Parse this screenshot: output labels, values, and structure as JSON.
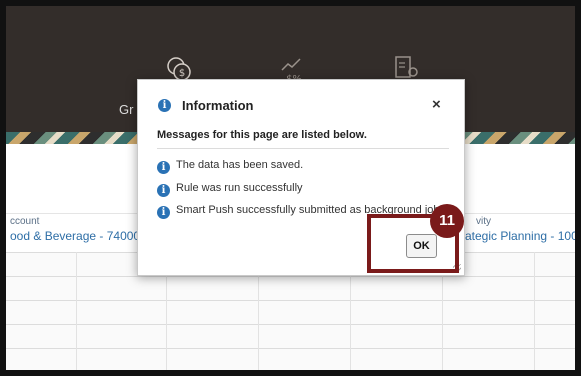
{
  "header": {
    "nav_label_partial": "Gr",
    "nav_icons": [
      "money-icon",
      "chart-percent-icon",
      "document-settings-icon"
    ]
  },
  "fields": [
    {
      "label": "ccount",
      "value": "ood & Beverage - 74000"
    },
    {
      "label": "vity",
      "value": "rategic Planning - 1000"
    }
  ],
  "dialog": {
    "title": "Information",
    "subtitle": "Messages for this page are listed below.",
    "messages": [
      "The data has been saved.",
      "Rule was run successfully",
      "Smart Push successfully submitted as background job."
    ],
    "ok_label": "OK",
    "close_glyph": "×",
    "info_glyph": "i"
  },
  "callout": {
    "step_number": "11"
  },
  "colors": {
    "header_bg": "#332d2a",
    "accent_blue": "#2a72b5",
    "callout": "#7a1a1a"
  }
}
